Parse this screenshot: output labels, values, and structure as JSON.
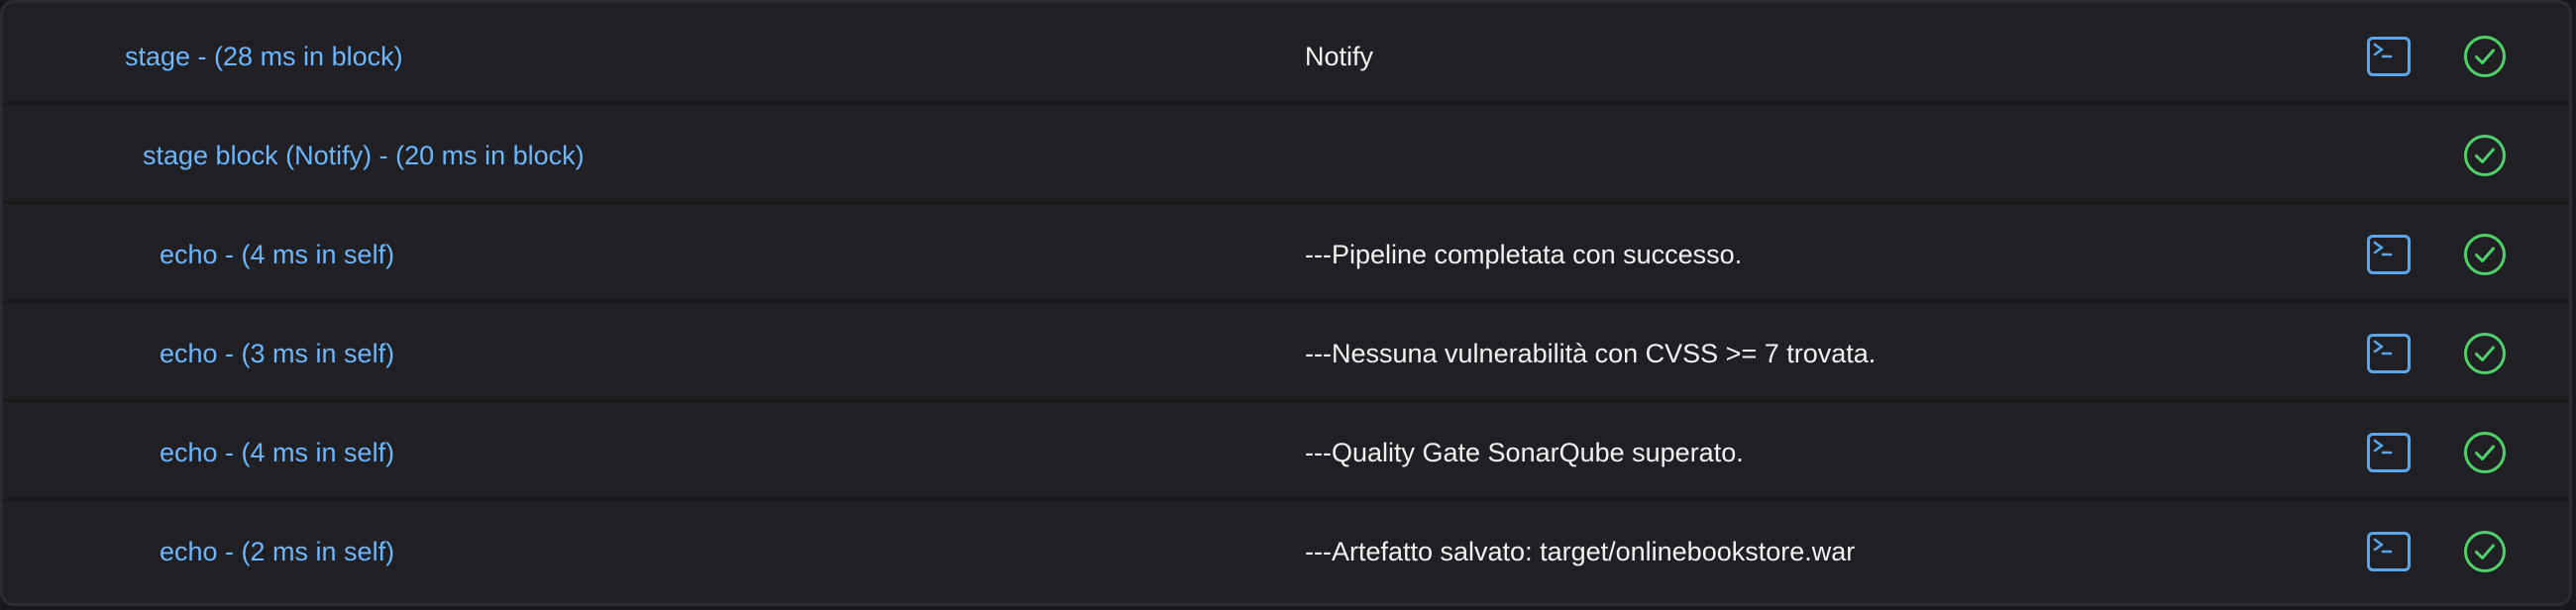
{
  "colors": {
    "label": "#6cb6ff",
    "message": "#f2f2f5",
    "success": "#4fd16a",
    "console": "#5aa6ec",
    "background": "#1f1f24"
  },
  "rows": [
    {
      "label": "stage - (28 ms in block)",
      "message": "Notify",
      "has_console": true,
      "status_icon": "success-check-icon"
    },
    {
      "label": "stage block (Notify) - (20 ms in block)",
      "message": "",
      "has_console": false,
      "status_icon": "success-check-icon"
    },
    {
      "label": "echo - (4 ms in self)",
      "message": "---Pipeline completata con successo.",
      "has_console": true,
      "status_icon": "success-check-icon"
    },
    {
      "label": "echo - (3 ms in self)",
      "message": "---Nessuna vulnerabilità con CVSS >= 7 trovata.",
      "has_console": true,
      "status_icon": "success-check-icon"
    },
    {
      "label": "echo - (4 ms in self)",
      "message": "---Quality Gate SonarQube superato.",
      "has_console": true,
      "status_icon": "success-check-icon"
    },
    {
      "label": "echo - (2 ms in self)",
      "message": "---Artefatto salvato: target/onlinebookstore.war",
      "has_console": true,
      "status_icon": "success-check-icon"
    }
  ]
}
